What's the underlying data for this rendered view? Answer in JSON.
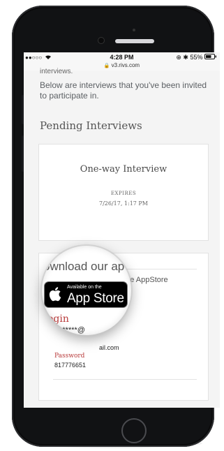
{
  "status_bar": {
    "signal": "●●○○○",
    "wifi_icon": "wifi-icon",
    "time": "4:28 PM",
    "battery": "⊕ ✱ 55%",
    "battery_icon": "battery-icon"
  },
  "address_bar": {
    "url": "v3.rivs.com",
    "lock_icon": "lock-icon"
  },
  "page": {
    "cut_text": "interviews.",
    "intro": "Below are interviews that you've been invited to participate in.",
    "section_title": "Pending Interviews"
  },
  "interview_card": {
    "title": "One-way Interview",
    "expires_label": "EXPIRES",
    "expires_date": "7/26/17, 1:17 PM"
  },
  "app_card": {
    "download_text": "Download our app from the AppStore",
    "download_visible_end": "from the AppStore",
    "magnified_text": "ownload our ap",
    "badge_small": "Available on the",
    "badge_big": "App Store",
    "login_label": "Login",
    "login_label_magnified": "ogin",
    "login_value": "a**********@  ail.com",
    "login_value_magnified": "**********@",
    "password_label": "Password",
    "password_value": "817776651"
  },
  "colors": {
    "accent_red": "#b83b3b",
    "phone_body": "#111214",
    "content_bg": "#f4f4f4"
  }
}
